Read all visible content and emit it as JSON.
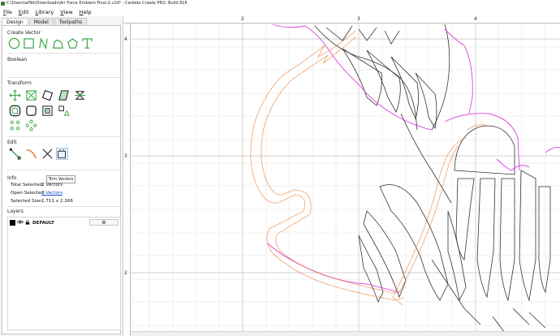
{
  "window": {
    "title": "C:\\Users\\wflbt\\Downloads\\Air Force Emblem Final-2.c2d* - Carbide Create PRO, Build 816"
  },
  "menu": [
    "File",
    "Edit",
    "Library",
    "View",
    "Help"
  ],
  "tabs": [
    {
      "label": "Design",
      "active": true
    },
    {
      "label": "Model",
      "active": false
    },
    {
      "label": "Toolpaths",
      "active": false
    }
  ],
  "sections": {
    "create_vector": "Create Vector",
    "boolean": "Boolean",
    "transform": "Transform",
    "edit": "Edit",
    "info": "Info",
    "layers": "Layers"
  },
  "info": {
    "total_selected_label": "Total Selected:",
    "total_selected_value": "2 Vectors",
    "open_selected_label": "Open Selected:",
    "open_selected_value": "2 Vectors",
    "selected_size_label": "Selected Size:",
    "selected_size_value": "1.711 x 2.266"
  },
  "layers": [
    {
      "name": "DEFAULT",
      "color": "#000000"
    }
  ],
  "tooltip": "Trim Vectors",
  "ruler": {
    "top_labels": [
      "2",
      "3",
      "4"
    ],
    "left_labels": [
      "4",
      "3",
      "2"
    ]
  },
  "colors": {
    "accent_green": "#39a845",
    "toolpath_orange": "#e8772a",
    "selection_magenta": "#e040e0",
    "vector_dark": "#333333",
    "grid": "#e6e6e6"
  },
  "icons": {
    "layer_visibility": "eye-icon",
    "layer_lock": "lock-icon",
    "layer_settings": "gear-icon"
  }
}
